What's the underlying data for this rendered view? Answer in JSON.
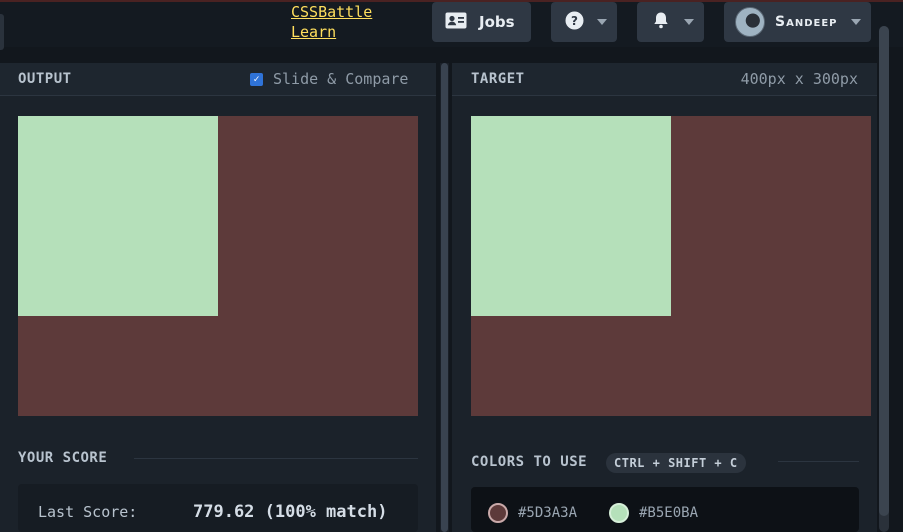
{
  "header": {
    "brand_line1": "CSSBattle",
    "brand_line2": "Learn",
    "jobs_label": "Jobs",
    "help_icon": "question-circle-icon",
    "bell_icon": "bell-icon",
    "user_name": "Sandeep"
  },
  "output": {
    "title": "OUTPUT",
    "slide_compare_label": "Slide & Compare",
    "slide_compare_checked": true
  },
  "target": {
    "title": "TARGET",
    "dimensions": "400px x 300px"
  },
  "canvas": {
    "background": "#5D3A3A",
    "square_color": "#B5E0BA"
  },
  "score": {
    "section_title": "YOUR SCORE",
    "last_score_label": "Last Score:",
    "last_score_value": "779.62 (100% match)"
  },
  "colors": {
    "section_title": "COLORS TO USE",
    "shortcut": "CTRL + SHIFT + C",
    "items": [
      {
        "hex": "#5D3A3A"
      },
      {
        "hex": "#B5E0BA"
      }
    ]
  }
}
